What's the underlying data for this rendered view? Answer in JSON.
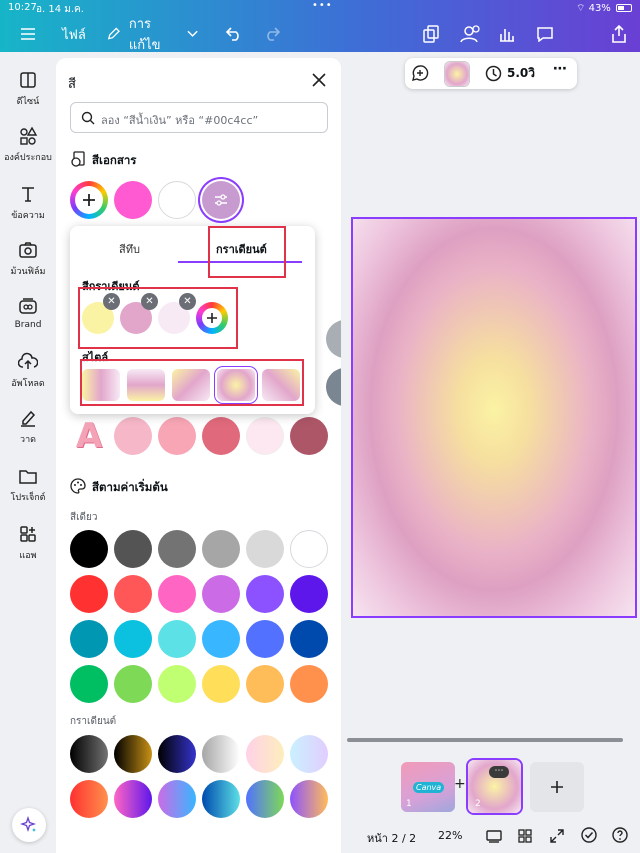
{
  "status": {
    "time": "10:27",
    "date": "อ. 14 ม.ค.",
    "battery": "43%",
    "dots": "•••"
  },
  "topbar": {
    "file": "ไฟล์",
    "edit": "การแก้ไข"
  },
  "sidebar": {
    "items": [
      {
        "label": "ดีไซน์",
        "icon": "layout-icon"
      },
      {
        "label": "องค์ประกอบ",
        "icon": "elements-icon"
      },
      {
        "label": "ข้อความ",
        "icon": "text-icon"
      },
      {
        "label": "ม้วนฟิล์ม",
        "icon": "camera-icon"
      },
      {
        "label": "Brand",
        "icon": "brand-icon"
      },
      {
        "label": "อัพโหลด",
        "icon": "upload-icon"
      },
      {
        "label": "วาด",
        "icon": "draw-icon"
      },
      {
        "label": "โปรเจ็กต์",
        "icon": "folder-icon"
      },
      {
        "label": "แอพ",
        "icon": "apps-icon"
      }
    ]
  },
  "panel": {
    "title": "สี",
    "search_placeholder": "ลอง “สีน้ำเงิน” หรือ “#00c4cc”",
    "doc_colors_title": "สีเอกสาร",
    "default_colors_title": "สีตามค่าเริ่มต้น",
    "solid_label": "สีเดียว",
    "gradient_label": "กราเดียนต์",
    "brand_swatches": [
      "#f6b8c8",
      "#f8a6b6",
      "#e06a7c",
      "#fde7f0",
      "#ad5668"
    ],
    "solid_rows": [
      [
        "#000000",
        "#545454",
        "#737373",
        "#a6a6a6",
        "#d9d9d9",
        "#ffffff"
      ],
      [
        "#ff3131",
        "#ff5757",
        "#ff66c4",
        "#cb6ce6",
        "#8c52ff",
        "#5e17eb"
      ],
      [
        "#0097b2",
        "#0cc0df",
        "#5ce1e6",
        "#38b6ff",
        "#5271ff",
        "#004aad"
      ],
      [
        "#00bf63",
        "#7ed957",
        "#c1ff72",
        "#ffde59",
        "#ffbd59",
        "#ff914d"
      ]
    ],
    "gradient_rows": [
      [
        [
          "#000000",
          "#737373"
        ],
        [
          "#000000",
          "#c89116"
        ],
        [
          "#000000",
          "#3533cd"
        ],
        [
          "#a6a6a6",
          "#ffffff"
        ],
        [
          "#ffd1e8",
          "#fdeebc"
        ],
        [
          "#c9f1ff",
          "#e2cdff"
        ]
      ],
      [
        [
          "#ff3131",
          "#ff914d"
        ],
        [
          "#ff66c4",
          "#5e17eb"
        ],
        [
          "#cb6ce6",
          "#38b6ff"
        ],
        [
          "#004aad",
          "#5de0e6"
        ],
        [
          "#5271ff",
          "#7ed957"
        ],
        [
          "#8c52ff",
          "#ffbd59"
        ]
      ]
    ]
  },
  "popup": {
    "tab_solid": "สีทึบ",
    "tab_gradient": "กราเดียนต์",
    "gradient_colors_title": "สีกราเดียนต์",
    "style_title": "สไตล์",
    "stops": [
      "#fbf3a4",
      "#e2a6cb",
      "#f7eaf5"
    ]
  },
  "toolbar": {
    "duration": "5.0วิ"
  },
  "bottom": {
    "page_label": "หน้า 2 / 2",
    "zoom": "22%",
    "thumb1_label": "1",
    "thumb2_label": "2",
    "thumb1_text": "Canva"
  }
}
